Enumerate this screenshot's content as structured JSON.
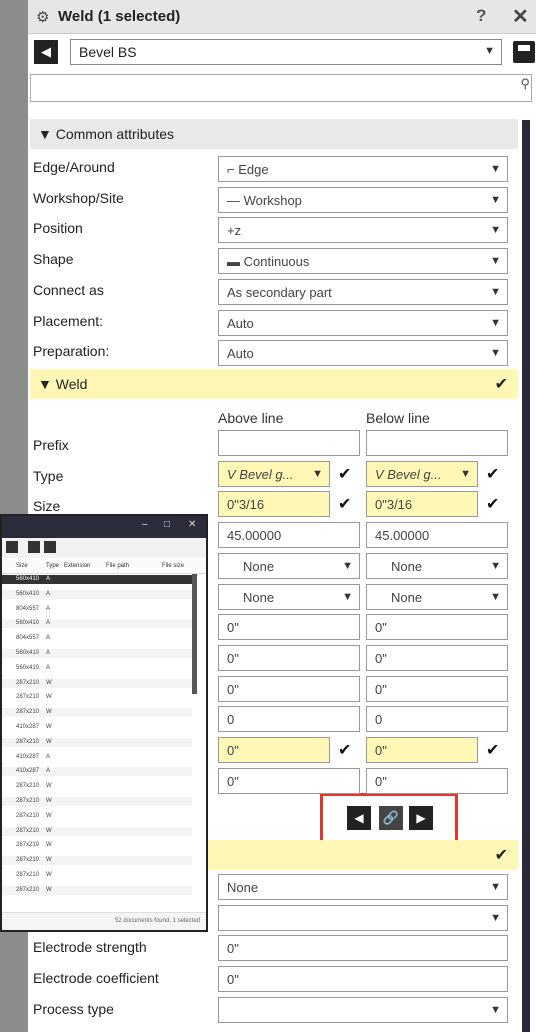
{
  "window": {
    "title": "Weld (1 selected)",
    "help": "?",
    "close": "✕"
  },
  "preset": {
    "value": "Bevel BS"
  },
  "search": {
    "placeholder": ""
  },
  "sections": {
    "common": "▼ Common attributes",
    "weld": "▼ Weld"
  },
  "attributes": [
    {
      "label": "Edge/Around",
      "value": "Edge",
      "icon": "edge-icon"
    },
    {
      "label": "Workshop/Site",
      "value": "Workshop",
      "icon": "workshop-icon"
    },
    {
      "label": "Position",
      "value": "+z"
    },
    {
      "label": "Shape",
      "value": "Continuous",
      "icon": "continuous-icon"
    },
    {
      "label": "Connect as",
      "value": "As secondary part"
    },
    {
      "label": "Placement:",
      "value": "Auto"
    },
    {
      "label": "Preparation:",
      "value": "Auto"
    }
  ],
  "weld": {
    "above_header": "Above line",
    "below_header": "Below line",
    "labels": {
      "prefix": "Prefix",
      "type": "Type",
      "size": "Size"
    },
    "rows": [
      {
        "above": "",
        "below": ""
      },
      {
        "above": "V Bevel g...",
        "below": "V Bevel g..."
      },
      {
        "above": "0\"3/16",
        "below": "0\"3/16"
      },
      {
        "above": "45.00000",
        "below": "45.00000"
      },
      {
        "above": "None",
        "below": "None"
      },
      {
        "above": "None",
        "below": "None"
      },
      {
        "above": "0\"",
        "below": "0\""
      },
      {
        "above": "0\"",
        "below": "0\""
      },
      {
        "above": "0\"",
        "below": "0\""
      },
      {
        "above": "0",
        "below": "0"
      },
      {
        "above": "0\"",
        "below": "0\""
      },
      {
        "above": "0\"",
        "below": "0\""
      }
    ]
  },
  "lower": [
    {
      "label": "",
      "value": "None"
    },
    {
      "label": "",
      "value": ""
    },
    {
      "label": "Electrode strength",
      "value": "0\""
    },
    {
      "label": "Electrode coefficient",
      "value": "0\""
    },
    {
      "label": "Process type",
      "value": ""
    }
  ],
  "popup": {
    "headers": [
      "Size",
      "Type",
      "Extension",
      "File path",
      "File size"
    ],
    "rows": [
      [
        "560x410",
        "A"
      ],
      [
        "560x410",
        "A"
      ],
      [
        "804x557",
        "A"
      ],
      [
        "560x410",
        "A"
      ],
      [
        "804x557",
        "A"
      ],
      [
        "560x410",
        "A"
      ],
      [
        "560x410",
        "A"
      ],
      [
        "287x210",
        "W"
      ],
      [
        "287x210",
        "W"
      ],
      [
        "287x210",
        "W"
      ],
      [
        "410x287",
        "W"
      ],
      [
        "287x210",
        "W"
      ],
      [
        "410x287",
        "A"
      ],
      [
        "410x287",
        "A"
      ],
      [
        "287x210",
        "W"
      ],
      [
        "287x210",
        "W"
      ],
      [
        "287x210",
        "W"
      ],
      [
        "287x210",
        "W"
      ],
      [
        "287x210",
        "W"
      ],
      [
        "287x210",
        "W"
      ],
      [
        "287x210",
        "W"
      ],
      [
        "287x210",
        "W"
      ]
    ],
    "status": "52 documents found, 1 selected"
  },
  "colors": {
    "highlight": "#fff7b6",
    "annotation": "#e2372f"
  }
}
